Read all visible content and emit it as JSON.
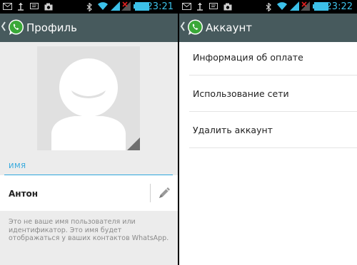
{
  "left_screen": {
    "status_bar": {
      "time": "23:21",
      "icons": [
        "mail-icon",
        "usb-icon",
        "sms-icon",
        "camera-icon",
        "bluetooth-icon",
        "wifi-icon",
        "signal-icon",
        "no-signal-icon",
        "battery-icon"
      ]
    },
    "action_bar": {
      "title": "Профиль"
    },
    "profile": {
      "name_label": "ИМЯ",
      "name_value": "Антон",
      "hint": "Это не ваше имя пользователя или идентификатор. Это имя будет отображаться у ваших контактов WhatsApp."
    }
  },
  "right_screen": {
    "status_bar": {
      "time": "23:22",
      "icons": [
        "mail-icon",
        "usb-icon",
        "sms-icon",
        "camera-icon",
        "bluetooth-icon",
        "wifi-icon",
        "signal-icon",
        "no-signal-icon",
        "battery-icon"
      ]
    },
    "action_bar": {
      "title": "Аккаунт"
    },
    "menu": [
      {
        "label": "Информация об оплате"
      },
      {
        "label": "Использование сети"
      },
      {
        "label": "Удалить аккаунт"
      }
    ]
  },
  "colors": {
    "action_bar": "#475a5d",
    "accent": "#2fa7dd",
    "status_time": "#3cc0e8",
    "whatsapp_green": "#3aa838"
  }
}
